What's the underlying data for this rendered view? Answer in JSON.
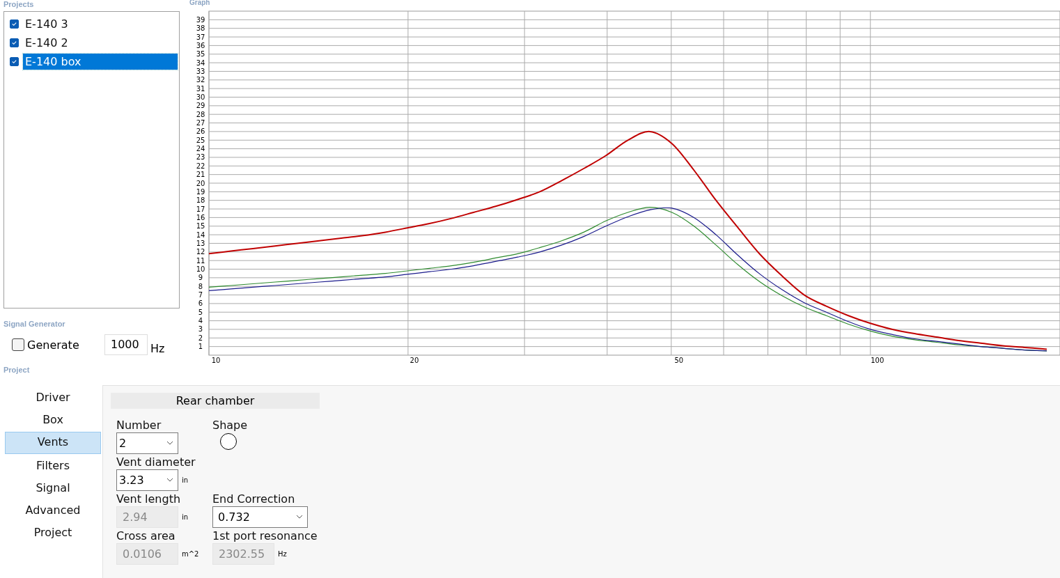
{
  "projects_label": "Projects",
  "graph_label": "Graph",
  "projects": [
    {
      "name": "E-140 3",
      "checked": true,
      "selected": false
    },
    {
      "name": "E-140 2",
      "checked": true,
      "selected": false
    },
    {
      "name": "E-140 box",
      "checked": true,
      "selected": true
    }
  ],
  "graph": {
    "chart_data": {
      "type": "line",
      "categories": [
        "10",
        null,
        null,
        null,
        null,
        null,
        null,
        null,
        null,
        "20",
        null,
        null,
        null,
        null,
        null,
        null,
        null,
        null,
        null,
        null,
        null,
        "50",
        null,
        null,
        null,
        null,
        null,
        null,
        null,
        null,
        "100",
        null,
        null,
        null,
        null,
        null,
        null,
        null,
        null
      ],
      "series": [
        {
          "color": "#c00000",
          "values": [
            11.8,
            12.1,
            12.4,
            12.7,
            13.0,
            13.3,
            13.6,
            13.9,
            14.3,
            14.8,
            15.3,
            15.9,
            16.6,
            17.3,
            18.1,
            19.0,
            20.3,
            21.7,
            23.2,
            25.0,
            26.0,
            24.6,
            21.5,
            18.0,
            14.8,
            11.7,
            9.2,
            7.0,
            5.7,
            4.6,
            3.7,
            3.0,
            2.5,
            2.1,
            1.7,
            1.4,
            1.1,
            0.9,
            0.7
          ]
        },
        {
          "color": "#2e8b2e",
          "values": [
            7.9,
            8.1,
            8.3,
            8.5,
            8.7,
            8.9,
            9.1,
            9.3,
            9.5,
            9.8,
            10.1,
            10.4,
            10.8,
            11.3,
            11.8,
            12.5,
            13.3,
            14.3,
            15.6,
            16.6,
            17.2,
            16.6,
            15.0,
            12.8,
            10.5,
            8.5,
            6.9,
            5.6,
            4.6,
            3.6,
            2.8,
            2.2,
            1.8,
            1.5,
            1.2,
            1.0,
            0.8,
            0.6,
            0.5
          ]
        },
        {
          "color": "#1a1a8c",
          "values": [
            7.5,
            7.7,
            7.9,
            8.1,
            8.3,
            8.5,
            8.7,
            8.9,
            9.1,
            9.4,
            9.7,
            10.0,
            10.4,
            10.9,
            11.4,
            12.0,
            12.8,
            13.8,
            15.0,
            16.1,
            16.9,
            17.1,
            16.0,
            14.0,
            11.6,
            9.4,
            7.6,
            6.1,
            5.0,
            3.9,
            3.0,
            2.4,
            1.9,
            1.6,
            1.3,
            1.0,
            0.8,
            0.6,
            0.5
          ]
        }
      ],
      "ylim": [
        0,
        40
      ],
      "grid": true,
      "yticks": [
        1,
        2,
        3,
        4,
        5,
        6,
        7,
        8,
        9,
        10,
        11,
        12,
        13,
        14,
        15,
        16,
        17,
        18,
        19,
        20,
        21,
        22,
        23,
        24,
        25,
        26,
        27,
        28,
        29,
        30,
        31,
        32,
        33,
        34,
        35,
        36,
        37,
        38,
        39
      ]
    }
  },
  "signal_generator": {
    "label": "Signal Generator",
    "generate": {
      "label": "Generate",
      "checked": false
    },
    "frequency": "1000",
    "unit": "Hz"
  },
  "project_label": "Project",
  "nav": [
    {
      "label": "Driver",
      "selected": false
    },
    {
      "label": "Box",
      "selected": false
    },
    {
      "label": "Vents",
      "selected": true
    },
    {
      "label": "Filters",
      "selected": false
    },
    {
      "label": "Signal",
      "selected": false
    },
    {
      "label": "Advanced",
      "selected": false
    },
    {
      "label": "Project",
      "selected": false
    }
  ],
  "section_title": "Rear chamber",
  "rows": [
    [
      {
        "label": "Number",
        "kind": "dropdown",
        "value": "2"
      },
      {
        "label": "Shape",
        "kind": "shape"
      }
    ],
    [
      {
        "label": "Vent diameter",
        "kind": "dropdown",
        "value": "3.23",
        "unit": "in"
      }
    ],
    [
      {
        "label": "Vent length",
        "kind": "readonly",
        "value": "2.94",
        "unit": "in"
      },
      {
        "label": "End Correction",
        "kind": "dropdown",
        "value": "0.732"
      }
    ],
    [
      {
        "label": "Cross area",
        "kind": "readonly",
        "value": "0.0106",
        "unit": "m^2"
      },
      {
        "label": "1st port resonance",
        "kind": "readonly",
        "value": "2302.55",
        "unit": "Hz"
      }
    ]
  ]
}
